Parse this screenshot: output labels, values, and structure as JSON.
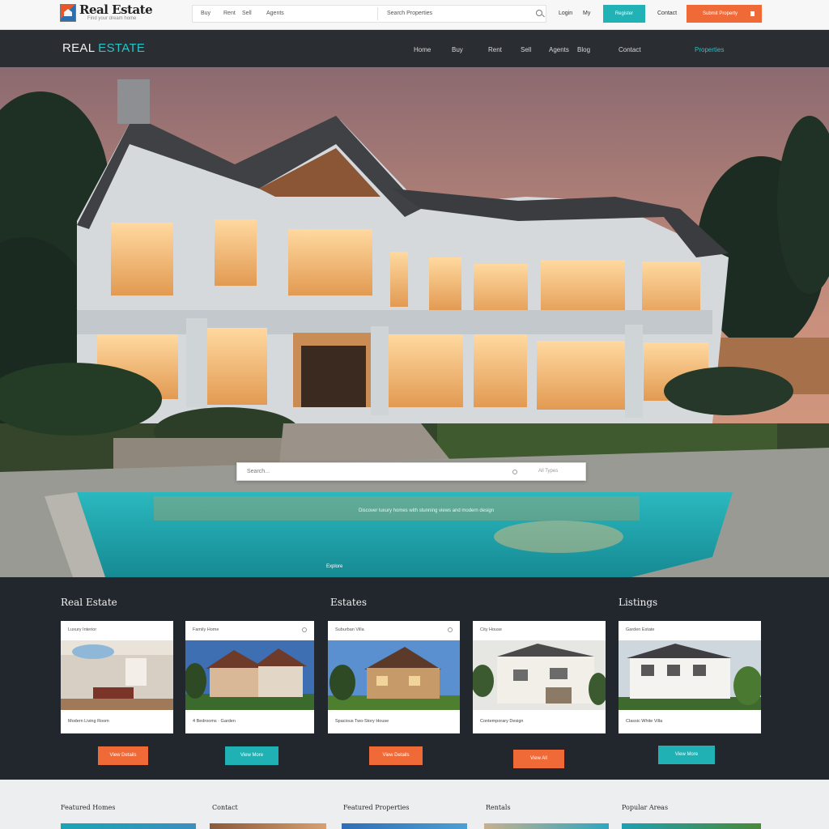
{
  "topbar": {
    "logo_title": "Real Estate",
    "logo_subtitle": "Find your dream home",
    "search_links": [
      "Buy",
      "Rent",
      "Sell",
      "Agents"
    ],
    "search_right_text": "Search  Properties",
    "utility_links": [
      "Login",
      "My"
    ],
    "teal_button": "Register",
    "contact_text": "Contact",
    "orange_button": "Submit Property"
  },
  "nav": {
    "brand_main": "REAL",
    "brand_accent": "ESTATE",
    "items": [
      "Home",
      "Buy",
      "Rent",
      "Sell",
      "Agents",
      "Blog",
      "Contact",
      "Properties"
    ]
  },
  "hero": {
    "search_placeholder": "Search...",
    "search_option": "All Types",
    "caption": "Discover luxury homes with stunning views and modern design",
    "small_text": "Explore"
  },
  "listings": {
    "heads": [
      "Real Estate",
      "Estates",
      "Listings"
    ],
    "cards": [
      {
        "top": "Luxury Interior",
        "foot": "Modern Living Room"
      },
      {
        "top": "Family Home",
        "foot": "4 Bedrooms · Garden"
      },
      {
        "top": "Suburban Villa",
        "foot": "Spacious Two-Story House"
      },
      {
        "top": "City House",
        "foot": "Contemporary Design"
      },
      {
        "top": "Garden Estate",
        "foot": "Classic White Villa"
      }
    ],
    "buttons": [
      "View Details",
      "View More",
      "View Details",
      "View All",
      "View More"
    ]
  },
  "footer": {
    "heads": [
      "Featured Homes",
      "Contact",
      "Featured Properties",
      "Rentals",
      "Popular Areas"
    ]
  },
  "colors": {
    "accent_teal": "#20b2b5",
    "accent_orange": "#f06a37",
    "nav_dark": "#2a2d32"
  }
}
